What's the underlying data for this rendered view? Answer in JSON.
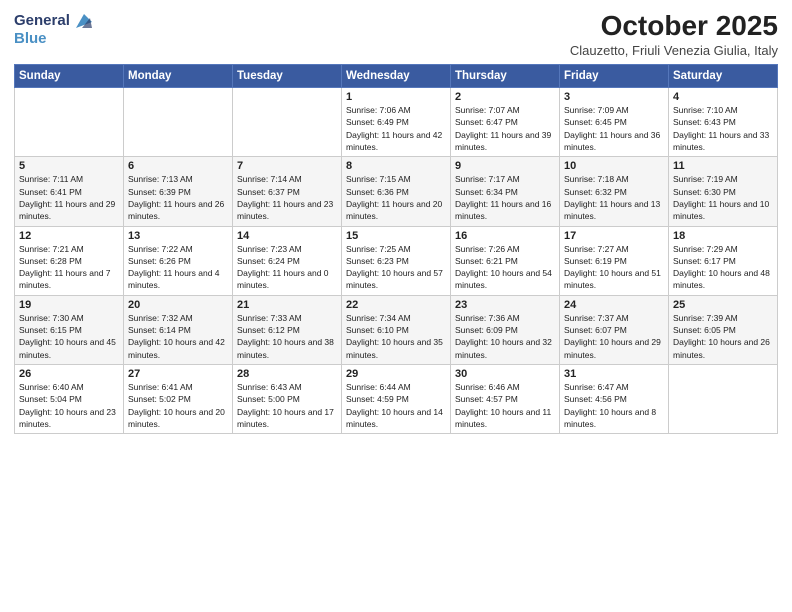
{
  "header": {
    "logo_line1": "General",
    "logo_line2": "Blue",
    "month": "October 2025",
    "location": "Clauzetto, Friuli Venezia Giulia, Italy"
  },
  "days_of_week": [
    "Sunday",
    "Monday",
    "Tuesday",
    "Wednesday",
    "Thursday",
    "Friday",
    "Saturday"
  ],
  "weeks": [
    [
      {
        "day": "",
        "info": ""
      },
      {
        "day": "",
        "info": ""
      },
      {
        "day": "",
        "info": ""
      },
      {
        "day": "1",
        "info": "Sunrise: 7:06 AM\nSunset: 6:49 PM\nDaylight: 11 hours and 42 minutes."
      },
      {
        "day": "2",
        "info": "Sunrise: 7:07 AM\nSunset: 6:47 PM\nDaylight: 11 hours and 39 minutes."
      },
      {
        "day": "3",
        "info": "Sunrise: 7:09 AM\nSunset: 6:45 PM\nDaylight: 11 hours and 36 minutes."
      },
      {
        "day": "4",
        "info": "Sunrise: 7:10 AM\nSunset: 6:43 PM\nDaylight: 11 hours and 33 minutes."
      }
    ],
    [
      {
        "day": "5",
        "info": "Sunrise: 7:11 AM\nSunset: 6:41 PM\nDaylight: 11 hours and 29 minutes."
      },
      {
        "day": "6",
        "info": "Sunrise: 7:13 AM\nSunset: 6:39 PM\nDaylight: 11 hours and 26 minutes."
      },
      {
        "day": "7",
        "info": "Sunrise: 7:14 AM\nSunset: 6:37 PM\nDaylight: 11 hours and 23 minutes."
      },
      {
        "day": "8",
        "info": "Sunrise: 7:15 AM\nSunset: 6:36 PM\nDaylight: 11 hours and 20 minutes."
      },
      {
        "day": "9",
        "info": "Sunrise: 7:17 AM\nSunset: 6:34 PM\nDaylight: 11 hours and 16 minutes."
      },
      {
        "day": "10",
        "info": "Sunrise: 7:18 AM\nSunset: 6:32 PM\nDaylight: 11 hours and 13 minutes."
      },
      {
        "day": "11",
        "info": "Sunrise: 7:19 AM\nSunset: 6:30 PM\nDaylight: 11 hours and 10 minutes."
      }
    ],
    [
      {
        "day": "12",
        "info": "Sunrise: 7:21 AM\nSunset: 6:28 PM\nDaylight: 11 hours and 7 minutes."
      },
      {
        "day": "13",
        "info": "Sunrise: 7:22 AM\nSunset: 6:26 PM\nDaylight: 11 hours and 4 minutes."
      },
      {
        "day": "14",
        "info": "Sunrise: 7:23 AM\nSunset: 6:24 PM\nDaylight: 11 hours and 0 minutes."
      },
      {
        "day": "15",
        "info": "Sunrise: 7:25 AM\nSunset: 6:23 PM\nDaylight: 10 hours and 57 minutes."
      },
      {
        "day": "16",
        "info": "Sunrise: 7:26 AM\nSunset: 6:21 PM\nDaylight: 10 hours and 54 minutes."
      },
      {
        "day": "17",
        "info": "Sunrise: 7:27 AM\nSunset: 6:19 PM\nDaylight: 10 hours and 51 minutes."
      },
      {
        "day": "18",
        "info": "Sunrise: 7:29 AM\nSunset: 6:17 PM\nDaylight: 10 hours and 48 minutes."
      }
    ],
    [
      {
        "day": "19",
        "info": "Sunrise: 7:30 AM\nSunset: 6:15 PM\nDaylight: 10 hours and 45 minutes."
      },
      {
        "day": "20",
        "info": "Sunrise: 7:32 AM\nSunset: 6:14 PM\nDaylight: 10 hours and 42 minutes."
      },
      {
        "day": "21",
        "info": "Sunrise: 7:33 AM\nSunset: 6:12 PM\nDaylight: 10 hours and 38 minutes."
      },
      {
        "day": "22",
        "info": "Sunrise: 7:34 AM\nSunset: 6:10 PM\nDaylight: 10 hours and 35 minutes."
      },
      {
        "day": "23",
        "info": "Sunrise: 7:36 AM\nSunset: 6:09 PM\nDaylight: 10 hours and 32 minutes."
      },
      {
        "day": "24",
        "info": "Sunrise: 7:37 AM\nSunset: 6:07 PM\nDaylight: 10 hours and 29 minutes."
      },
      {
        "day": "25",
        "info": "Sunrise: 7:39 AM\nSunset: 6:05 PM\nDaylight: 10 hours and 26 minutes."
      }
    ],
    [
      {
        "day": "26",
        "info": "Sunrise: 6:40 AM\nSunset: 5:04 PM\nDaylight: 10 hours and 23 minutes."
      },
      {
        "day": "27",
        "info": "Sunrise: 6:41 AM\nSunset: 5:02 PM\nDaylight: 10 hours and 20 minutes."
      },
      {
        "day": "28",
        "info": "Sunrise: 6:43 AM\nSunset: 5:00 PM\nDaylight: 10 hours and 17 minutes."
      },
      {
        "day": "29",
        "info": "Sunrise: 6:44 AM\nSunset: 4:59 PM\nDaylight: 10 hours and 14 minutes."
      },
      {
        "day": "30",
        "info": "Sunrise: 6:46 AM\nSunset: 4:57 PM\nDaylight: 10 hours and 11 minutes."
      },
      {
        "day": "31",
        "info": "Sunrise: 6:47 AM\nSunset: 4:56 PM\nDaylight: 10 hours and 8 minutes."
      },
      {
        "day": "",
        "info": ""
      }
    ]
  ]
}
